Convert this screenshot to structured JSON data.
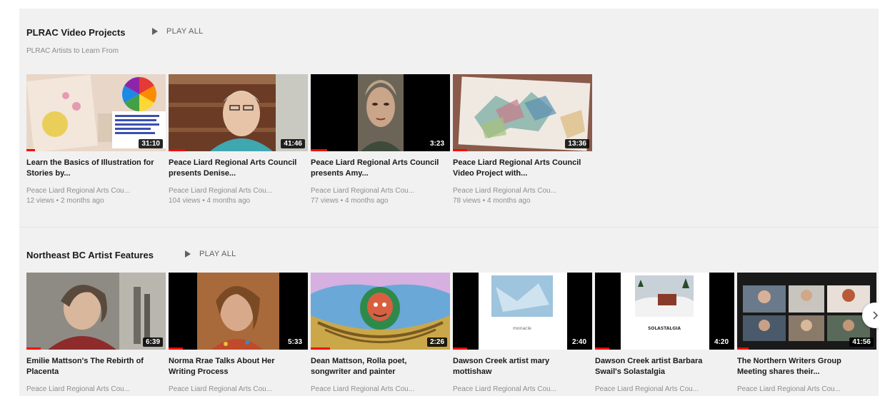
{
  "sections": [
    {
      "title": "PLRAC Video Projects",
      "play_all": "PLAY ALL",
      "subtitle": "PLRAC Artists to Learn From",
      "videos": [
        {
          "title": "Learn the Basics of Illustration for Stories by...",
          "channel": "Peace Liard Regional Arts Cou...",
          "meta": "12 views • 2 months ago",
          "duration": "31:10",
          "progress": 0.06
        },
        {
          "title": "Peace Liard Regional Arts Council presents Denise...",
          "channel": "Peace Liard Regional Arts Cou...",
          "meta": "104 views • 4 months ago",
          "duration": "41:46",
          "progress": 0.12
        },
        {
          "title": "Peace Liard Regional Arts Council presents Amy...",
          "channel": "Peace Liard Regional Arts Cou...",
          "meta": "77 views • 4 months ago",
          "duration": "3:23",
          "progress": 0.12
        },
        {
          "title": "Peace Liard Regional Arts Council Video Project with...",
          "channel": "Peace Liard Regional Arts Cou...",
          "meta": "78 views • 4 months ago",
          "duration": "13:36",
          "progress": 0.1
        }
      ]
    },
    {
      "title": "Northeast BC Artist Features",
      "play_all": "PLAY ALL",
      "videos": [
        {
          "title": "Emilie Mattson's The Rebirth of Placenta",
          "channel": "Peace Liard Regional Arts Cou...",
          "duration": "6:39",
          "progress": 0.1,
          "caption": ""
        },
        {
          "title": "Norma Rrae Talks About Her Writing Process",
          "channel": "Peace Liard Regional Arts Cou...",
          "duration": "5:33",
          "progress": 0.1,
          "caption": ""
        },
        {
          "title": "Dean Mattson, Rolla poet, songwriter and painter",
          "channel": "Peace Liard Regional Arts Cou...",
          "duration": "2:26",
          "progress": 0.14,
          "caption": ""
        },
        {
          "title": "Dawson Creek artist mary mottishaw",
          "channel": "Peace Liard Regional Arts Cou...",
          "duration": "2:40",
          "progress": 0.1,
          "caption": "monacle"
        },
        {
          "title": "Dawson Creek artist Barbara Swail's Solastalgia",
          "channel": "Peace Liard Regional Arts Cou...",
          "duration": "4:20",
          "progress": 0.1,
          "caption": "SOLASTALGIA"
        },
        {
          "title": "The Northern Writers Group Meeting shares their...",
          "channel": "Peace Liard Regional Arts Cou...",
          "duration": "41:56",
          "progress": 0.08,
          "caption": ""
        }
      ]
    }
  ],
  "icons": {
    "play_all": "play-icon",
    "next": "chevron-right-icon"
  },
  "colors": {
    "progress": "#ff0000",
    "panel_bg": "#f1f1f1"
  }
}
